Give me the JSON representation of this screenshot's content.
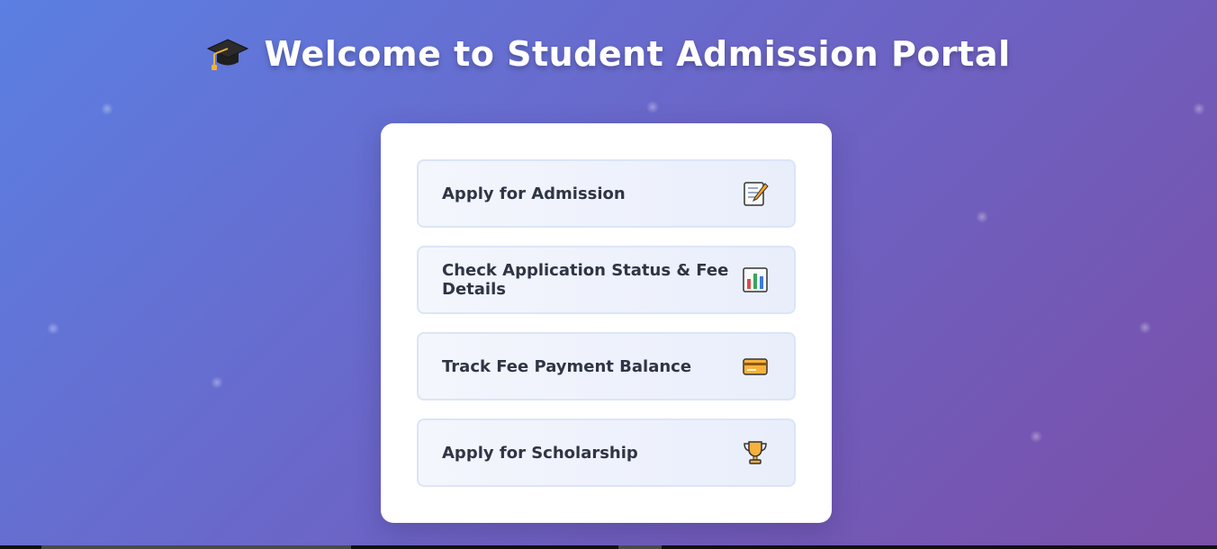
{
  "header": {
    "title": "Welcome to Student Admission Portal",
    "icon": "graduation-cap-icon"
  },
  "menu": {
    "items": [
      {
        "label": "Apply for Admission",
        "icon": "memo-icon"
      },
      {
        "label": "Check Application Status & Fee Details",
        "icon": "bar-chart-icon"
      },
      {
        "label": "Track Fee Payment Balance",
        "icon": "credit-card-icon"
      },
      {
        "label": "Apply for Scholarship",
        "icon": "trophy-icon"
      }
    ]
  },
  "colors": {
    "background_start": "#5b7fe2",
    "background_end": "#7a4fa8",
    "card": "#ffffff",
    "option_border": "#dce4f8",
    "option_text": "#2f3545"
  }
}
